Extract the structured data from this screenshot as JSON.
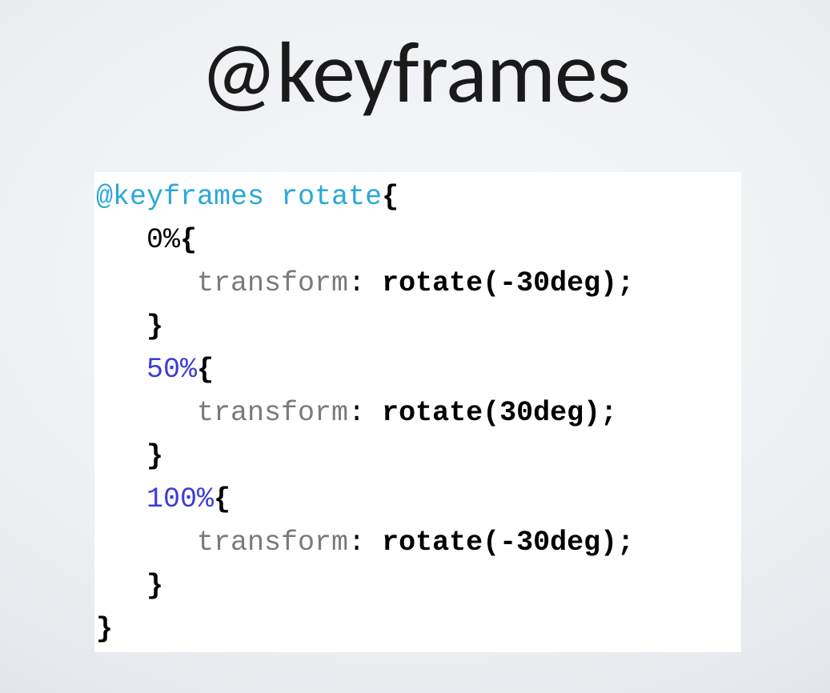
{
  "slide": {
    "title": "@keyframes"
  },
  "code": {
    "atrule_keyword": "@keyframes",
    "atrule_name": "rotate",
    "open_brace": "{",
    "close_brace": "}",
    "rules": [
      {
        "selector_num": "0",
        "selector_pct": "%",
        "open": "{",
        "prop": "transform",
        "colon": ":",
        "space": " ",
        "value": "rotate(-30deg)",
        "semicolon": ";",
        "close": "}"
      },
      {
        "selector_num": "50",
        "selector_pct": "%",
        "open": "{",
        "prop": "transform",
        "colon": ":",
        "space": " ",
        "value": "rotate(30deg)",
        "semicolon": ";",
        "close": "}"
      },
      {
        "selector_num": "100",
        "selector_pct": "%",
        "open": "{",
        "prop": "transform",
        "colon": ":",
        "space": " ",
        "value": "rotate(-30deg)",
        "semicolon": ";",
        "close": "}"
      }
    ]
  }
}
